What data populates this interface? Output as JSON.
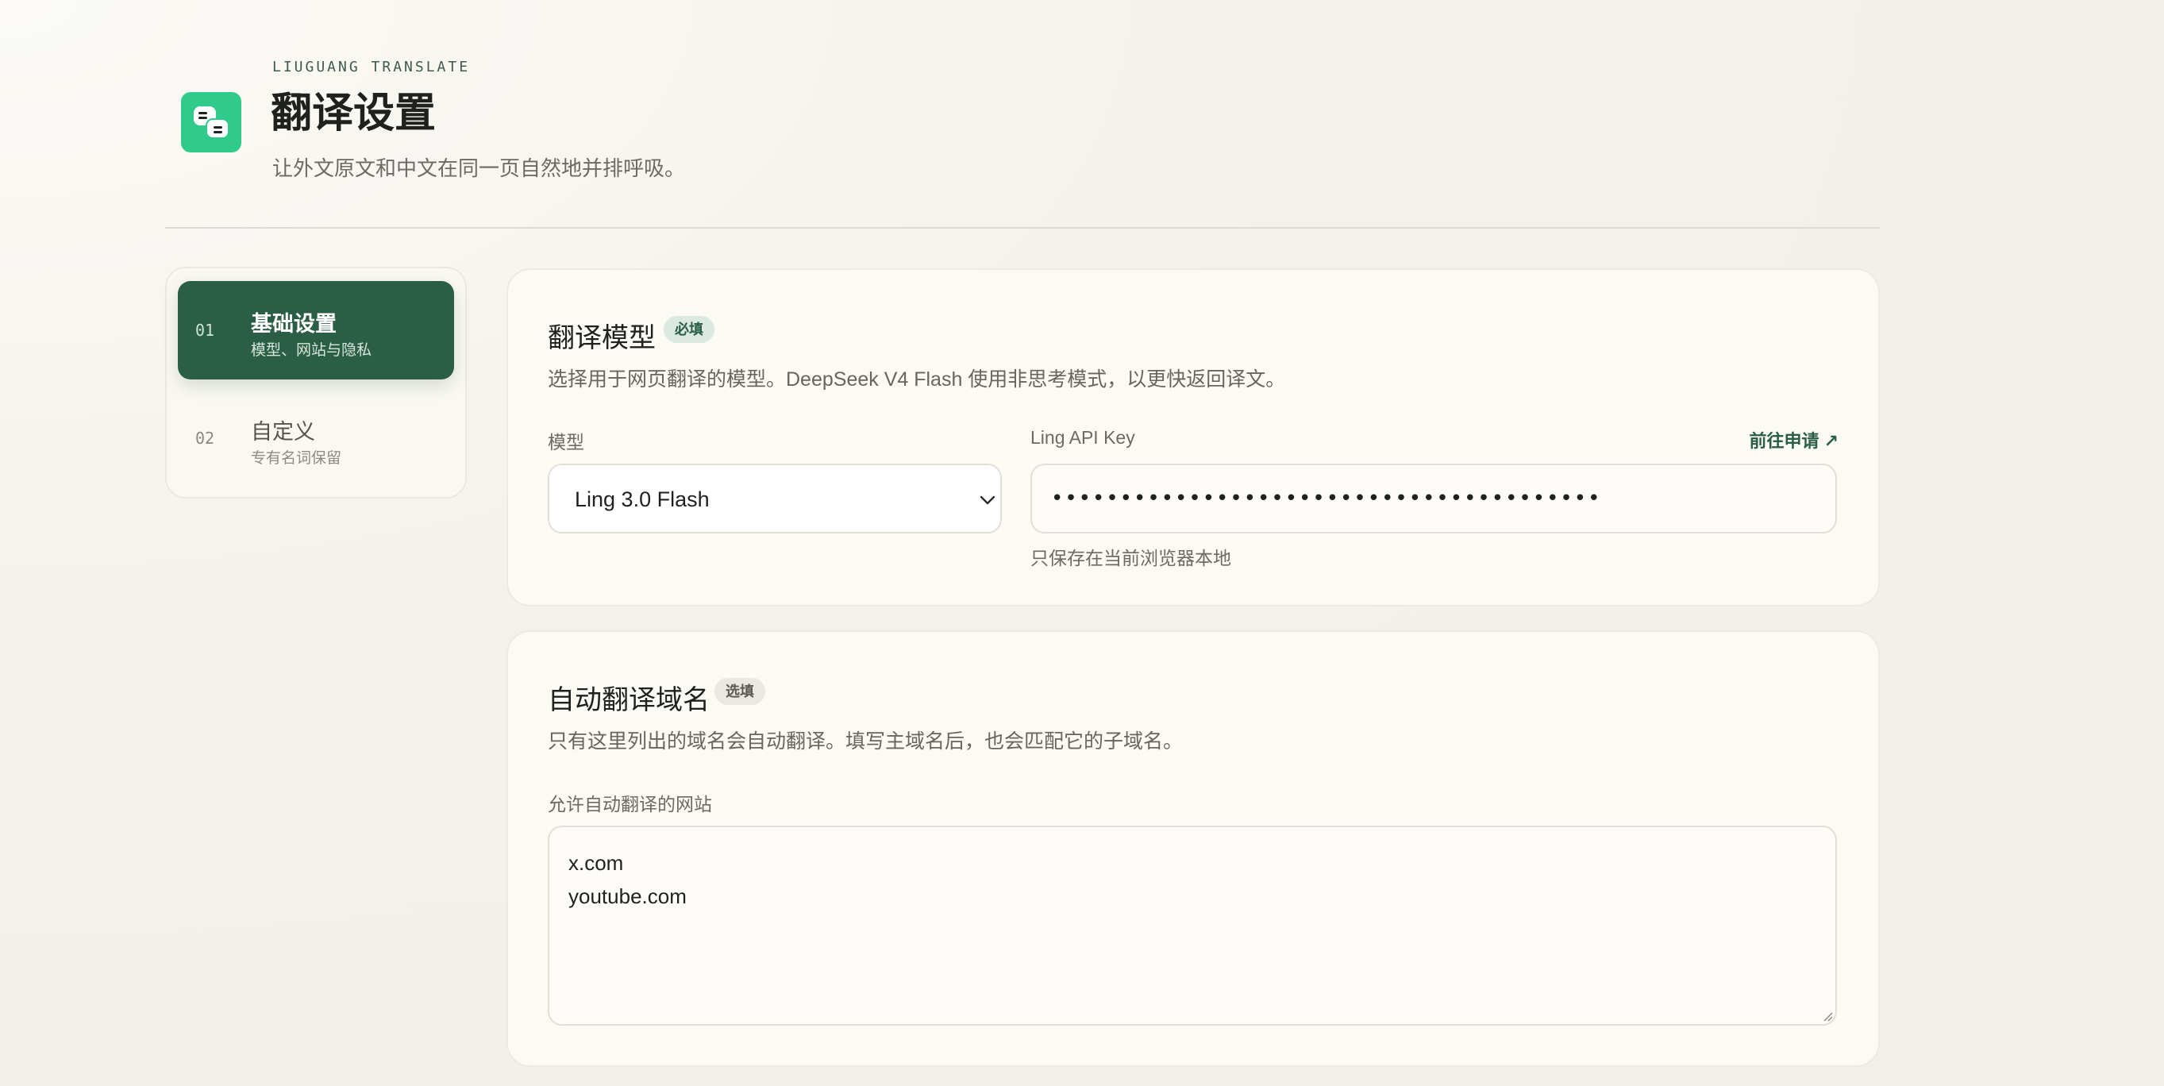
{
  "header": {
    "brand": "LIUGUANG TRANSLATE",
    "title": "翻译设置",
    "subtitle": "让外文原文和中文在同一页自然地并排呼吸。",
    "logo_icon": "chat-bubbles-icon",
    "accent_color": "#2fca8c"
  },
  "sidebar": {
    "items": [
      {
        "num": "01",
        "title": "基础设置",
        "subtitle": "模型、网站与隐私",
        "active": true
      },
      {
        "num": "02",
        "title": "自定义",
        "subtitle": "专有名词保留",
        "active": false
      }
    ],
    "active_color": "#2a5e46"
  },
  "model_card": {
    "title": "翻译模型",
    "badge": "必填",
    "description": "选择用于网页翻译的模型。DeepSeek V4 Flash 使用非思考模式，以更快返回译文。",
    "model_label": "模型",
    "model_value": "Ling 3.0 Flash",
    "key_label": "Ling API Key",
    "apply_link": "前往申请 ↗",
    "key_value": "••••••••••••••••••••••••••••••••••••••••",
    "key_hint": "只保存在当前浏览器本地"
  },
  "domain_card": {
    "title": "自动翻译域名",
    "badge": "选填",
    "description": "只有这里列出的域名会自动翻译。填写主域名后，也会匹配它的子域名。",
    "field_label": "允许自动翻译的网站",
    "domains": [
      "x.com",
      "youtube.com"
    ]
  }
}
